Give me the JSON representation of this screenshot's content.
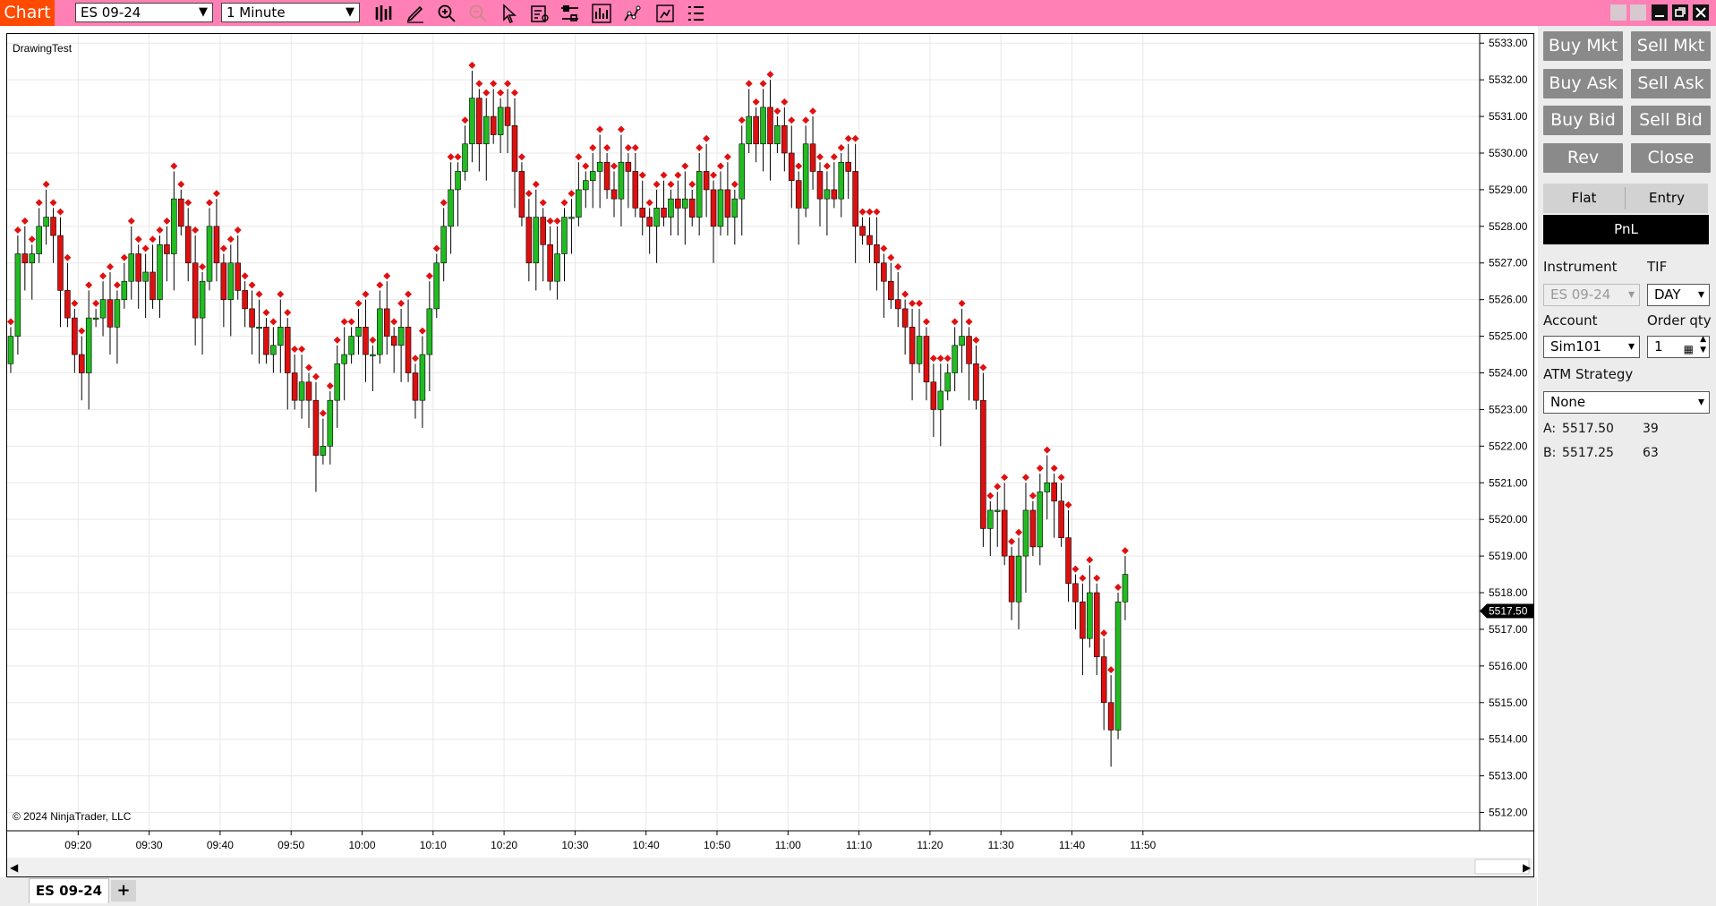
{
  "titlebar": {
    "chart_label": "Chart",
    "instrument": "ES 09-24",
    "interval": "1 Minute",
    "toolbar_icons": [
      "bar-type-icon",
      "drawing-pencil-icon",
      "zoom-in-icon",
      "zoom-out-icon",
      "pointer-icon",
      "properties-icon",
      "data-box-icon",
      "indicators-icon",
      "strategies-icon",
      "templates-icon",
      "more-options-icon"
    ],
    "window_buttons": [
      "restore-icon",
      "maximize-icon",
      "minimize-icon",
      "float-icon",
      "close-icon"
    ],
    "bg_color": "#ff80b4",
    "label_color": "#ff4a00"
  },
  "chart": {
    "name": "DrawingTest",
    "copyright": "© 2024 NinjaTrader, LLC",
    "current_price_label": "5517.50",
    "scroll_arrows": [
      "◀",
      "▶"
    ]
  },
  "chart_data": {
    "type": "candlestick",
    "instrument": "ES 09-24",
    "timeframe": "1 Minute",
    "time_ticks": [
      "09:20",
      "09:30",
      "09:40",
      "09:50",
      "10:00",
      "10:10",
      "10:20",
      "10:30",
      "10:40",
      "10:50",
      "11:00",
      "11:10",
      "11:20",
      "11:30",
      "11:40",
      "11:50"
    ],
    "price_ticks": [
      "5533.00",
      "5532.00",
      "5531.00",
      "5530.00",
      "5529.00",
      "5528.00",
      "5527.00",
      "5526.00",
      "5525.00",
      "5524.00",
      "5523.00",
      "5522.00",
      "5521.00",
      "5520.00",
      "5519.00",
      "5518.00",
      "5517.00",
      "5516.00",
      "5515.00",
      "5514.00",
      "5513.00",
      "5512.00"
    ],
    "ylim": [
      5511.5,
      5533.25
    ],
    "first_bar_time": "09:10",
    "bar_minutes": 1,
    "closes": [
      5525.0,
      5527.25,
      5527.0,
      5527.25,
      5528.0,
      5528.25,
      5527.75,
      5526.25,
      5525.5,
      5524.5,
      5524.0,
      5525.5,
      5525.5,
      5526.0,
      5525.25,
      5526.0,
      5526.5,
      5527.25,
      5526.5,
      5526.75,
      5526.0,
      5527.5,
      5527.25,
      5528.75,
      5528.0,
      5527.0,
      5525.5,
      5526.5,
      5528.0,
      5527.0,
      5526.0,
      5527.0,
      5526.25,
      5525.75,
      5525.25,
      5525.25,
      5524.5,
      5524.75,
      5525.25,
      5524.0,
      5523.25,
      5523.75,
      5523.25,
      5521.75,
      5522.0,
      5523.25,
      5524.25,
      5524.5,
      5525.0,
      5525.25,
      5524.5,
      5524.5,
      5525.75,
      5525.0,
      5524.75,
      5525.25,
      5524.0,
      5523.25,
      5524.5,
      5525.75,
      5527.0,
      5528.0,
      5529.0,
      5529.5,
      5530.25,
      5531.5,
      5530.25,
      5531.0,
      5530.5,
      5531.25,
      5530.75,
      5529.5,
      5528.25,
      5527.0,
      5528.25,
      5527.5,
      5526.5,
      5527.25,
      5528.25,
      5528.25,
      5529.0,
      5529.25,
      5529.5,
      5529.75,
      5529.0,
      5528.75,
      5529.75,
      5529.5,
      5528.5,
      5528.25,
      5528.0,
      5528.5,
      5528.25,
      5528.75,
      5528.5,
      5528.75,
      5528.25,
      5529.5,
      5529.0,
      5528.0,
      5529.0,
      5528.25,
      5528.75,
      5530.25,
      5531.0,
      5530.25,
      5531.25,
      5530.25,
      5530.75,
      5530.0,
      5529.25,
      5528.5,
      5530.25,
      5529.5,
      5528.75,
      5529.0,
      5528.75,
      5529.75,
      5529.5,
      5528.0,
      5527.75,
      5527.5,
      5527.0,
      5526.5,
      5526.0,
      5525.75,
      5525.25,
      5524.25,
      5525.0,
      5523.75,
      5523.0,
      5523.5,
      5524.0,
      5524.75,
      5525.0,
      5524.25,
      5523.25,
      5519.75,
      5520.25,
      5520.25,
      5519.0,
      5517.75,
      5519.0,
      5520.25,
      5519.25,
      5520.75,
      5521.0,
      5520.5,
      5519.5,
      5518.25,
      5517.75,
      5516.75,
      5518.0,
      5516.25,
      5515.0,
      5514.25,
      5517.75,
      5518.5
    ]
  },
  "orders": {
    "buy_mkt": "Buy Mkt",
    "sell_mkt": "Sell Mkt",
    "buy_ask": "Buy Ask",
    "sell_ask": "Sell Ask",
    "buy_bid": "Buy Bid",
    "sell_bid": "Sell Bid",
    "rev": "Rev",
    "close": "Close",
    "flat": "Flat",
    "entry": "Entry",
    "pnl": "PnL",
    "instrument_label": "Instrument",
    "instrument_value": "ES 09-24",
    "tif_label": "TIF",
    "tif_value": "DAY",
    "account_label": "Account",
    "account_value": "Sim101",
    "qty_label": "Order qty",
    "qty_value": "1",
    "atm_label": "ATM Strategy",
    "atm_value": "None",
    "ask_label": "A:",
    "ask_price": "5517.50",
    "ask_size": "39",
    "bid_label": "B:",
    "bid_price": "5517.25",
    "bid_size": "63"
  },
  "tabs": {
    "active": "ES 09-24",
    "add": "+"
  }
}
